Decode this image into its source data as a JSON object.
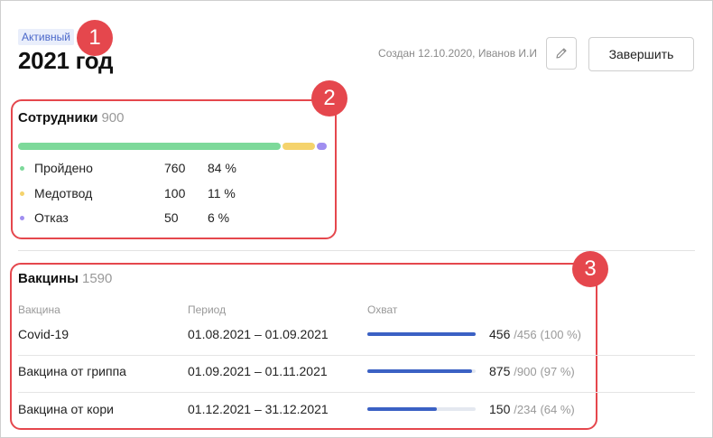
{
  "header": {
    "status": "Активный",
    "title": "2021 год",
    "created": "Создан 12.10.2020, Иванов И.И",
    "edit_icon": "pencil-icon",
    "finish_label": "Завершить"
  },
  "annotations": [
    "1",
    "2",
    "3"
  ],
  "employees": {
    "title": "Сотрудники",
    "count": "900",
    "items": [
      {
        "label": "Пройдено",
        "value": "760",
        "percent": "84 %",
        "share": 0.84,
        "color": "#7dd99a"
      },
      {
        "label": "Медотвод",
        "value": "100",
        "percent": "11 %",
        "share": 0.11,
        "color": "#f5d36c"
      },
      {
        "label": "Отказ",
        "value": "50",
        "percent": "6 %",
        "share": 0.06,
        "color": "#a08ef0"
      }
    ]
  },
  "vaccines": {
    "title": "Вакцины",
    "count": "1590",
    "columns": [
      "Вакцина",
      "Период",
      "Охват"
    ],
    "rows": [
      {
        "name": "Covid-19",
        "period": "01.08.2021 – 01.09.2021",
        "done": "456",
        "total": "/456",
        "percent": "(100 %)",
        "fraction": 1.0
      },
      {
        "name": "Вакцина от гриппа",
        "period": "01.09.2021 – 01.11.2021",
        "done": "875",
        "total": "/900",
        "percent": "(97 %)",
        "fraction": 0.97
      },
      {
        "name": "Вакцина от кори",
        "period": "01.12.2021 – 31.12.2021",
        "done": "150",
        "total": "/234",
        "percent": "(64 %)",
        "fraction": 0.64
      }
    ]
  },
  "colors": {
    "accent": "#3b61c4",
    "annotation": "#e5474d"
  }
}
